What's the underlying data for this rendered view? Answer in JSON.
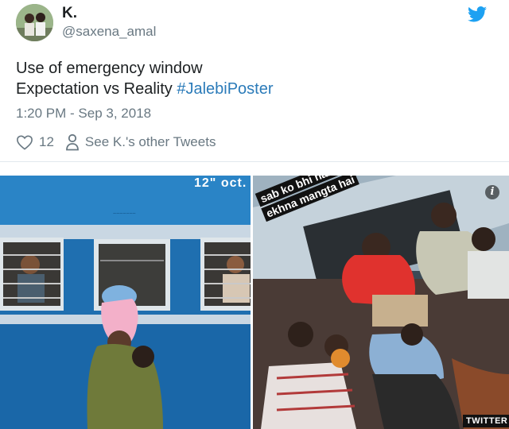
{
  "user": {
    "display_name": "K.",
    "handle": "@saxena_amal"
  },
  "tweet": {
    "line1": "Use of emergency window",
    "line2_prefix": "Expectation vs Reality ",
    "hashtag": "#JalebiPoster",
    "timestamp": "1:20 PM - Sep 3, 2018",
    "like_count": "12",
    "other_tweets_label": "See K.'s other Tweets"
  },
  "media": {
    "left_stamp": "12\" oct.",
    "overlay_line1": "sab ko bhi nazara",
    "overlay_line2": "ekhna mangta hai",
    "info_glyph": "i",
    "watermark": "TWITTER"
  },
  "colors": {
    "accent": "#1da1f2",
    "link": "#2b7bb9",
    "muted": "#697882"
  },
  "icons": {
    "brand": "twitter-bird-icon",
    "like": "heart-icon",
    "profile": "person-icon",
    "info": "info-icon"
  }
}
